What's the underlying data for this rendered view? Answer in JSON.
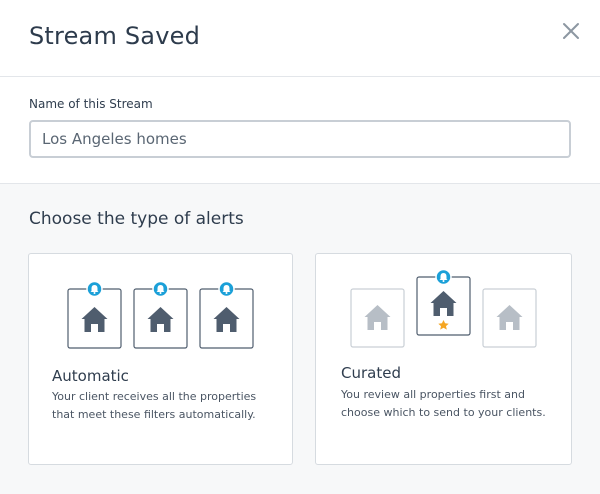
{
  "dialog": {
    "title": "Stream Saved",
    "close_icon": "close-icon"
  },
  "name_field": {
    "label": "Name of this Stream",
    "value": "Los Angeles homes"
  },
  "alerts": {
    "title": "Choose the type of alerts",
    "options": [
      {
        "title": "Automatic",
        "description": "Your client receives all the properties that meet these filters automatically.",
        "icons": [
          "house-icon",
          "bell-icon"
        ]
      },
      {
        "title": "Curated",
        "description": "You review all properties first and choose which to send to your clients.",
        "icons": [
          "house-icon",
          "bell-icon",
          "star-icon"
        ]
      }
    ]
  },
  "colors": {
    "accent": "#1ba0d8",
    "house_dark": "#4f5d6e",
    "house_light": "#b7bec6",
    "star": "#f5a623"
  }
}
